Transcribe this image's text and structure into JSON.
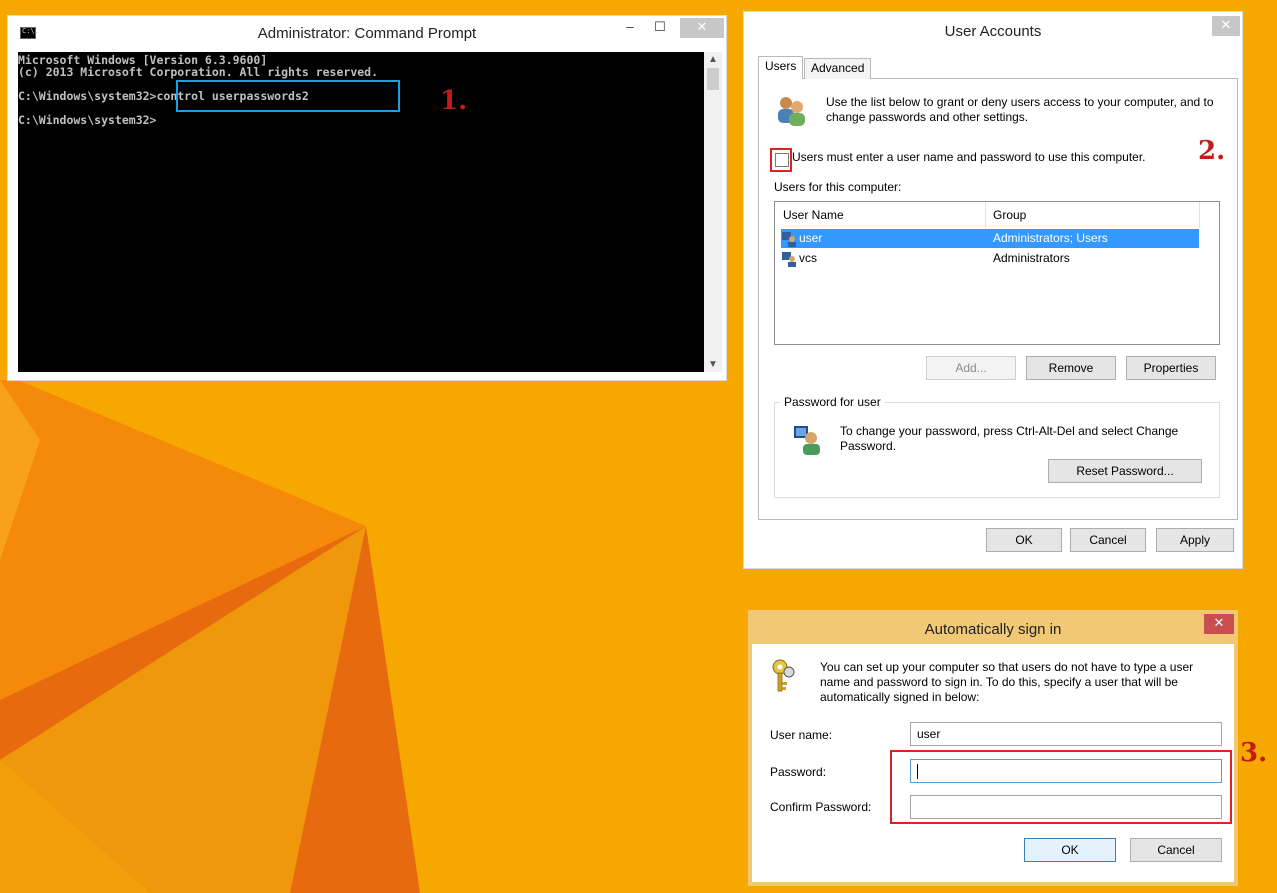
{
  "cmd": {
    "title": "Administrator: Command Prompt",
    "icon_label": "C:\\.",
    "min_glyph": "–",
    "max_glyph": "☐",
    "close_glyph": "✕",
    "lines": [
      "Microsoft Windows [Version 6.3.9600]",
      "(c) 2013 Microsoft Corporation. All rights reserved.",
      "C:\\Windows\\system32>control userpasswords2",
      "C:\\Windows\\system32>"
    ]
  },
  "annotations": {
    "step1": "1.",
    "step2": "2.",
    "step3": "3."
  },
  "user_accounts": {
    "title": "User Accounts",
    "close_glyph": "✕",
    "tabs": [
      "Users",
      "Advanced"
    ],
    "intro": "Use the list below to grant or deny users access to your computer, and to change passwords and other settings.",
    "checkbox_label": "Users must enter a user name and password to use this computer.",
    "checkbox_checked": false,
    "list_label": "Users for this computer:",
    "columns": [
      "User Name",
      "Group"
    ],
    "rows": [
      {
        "name": "user",
        "group": "Administrators; Users",
        "selected": true
      },
      {
        "name": "vcs",
        "group": "Administrators",
        "selected": false
      }
    ],
    "buttons": {
      "add": "Add...",
      "remove": "Remove",
      "properties": "Properties"
    },
    "password_group": "Password for user",
    "password_text": "To change your password, press Ctrl-Alt-Del and select Change Password.",
    "reset_password": "Reset Password...",
    "ok": "OK",
    "cancel": "Cancel",
    "apply": "Apply"
  },
  "auto_sign_in": {
    "title": "Automatically sign in",
    "close_glyph": "✕",
    "description": "You can set up your computer so that users do not have to type a user name and password to sign in. To do this, specify a user that will be automatically signed in below:",
    "user_name_label": "User name:",
    "user_name_value": "user",
    "password_label": "Password:",
    "password_value": "",
    "confirm_label": "Confirm Password:",
    "confirm_value": "",
    "ok": "OK",
    "cancel": "Cancel"
  },
  "colors": {
    "desktop": "#f7a800",
    "selection": "#3399ff",
    "highlight_blue": "#1aa0e6",
    "highlight_red": "#dd2222"
  }
}
